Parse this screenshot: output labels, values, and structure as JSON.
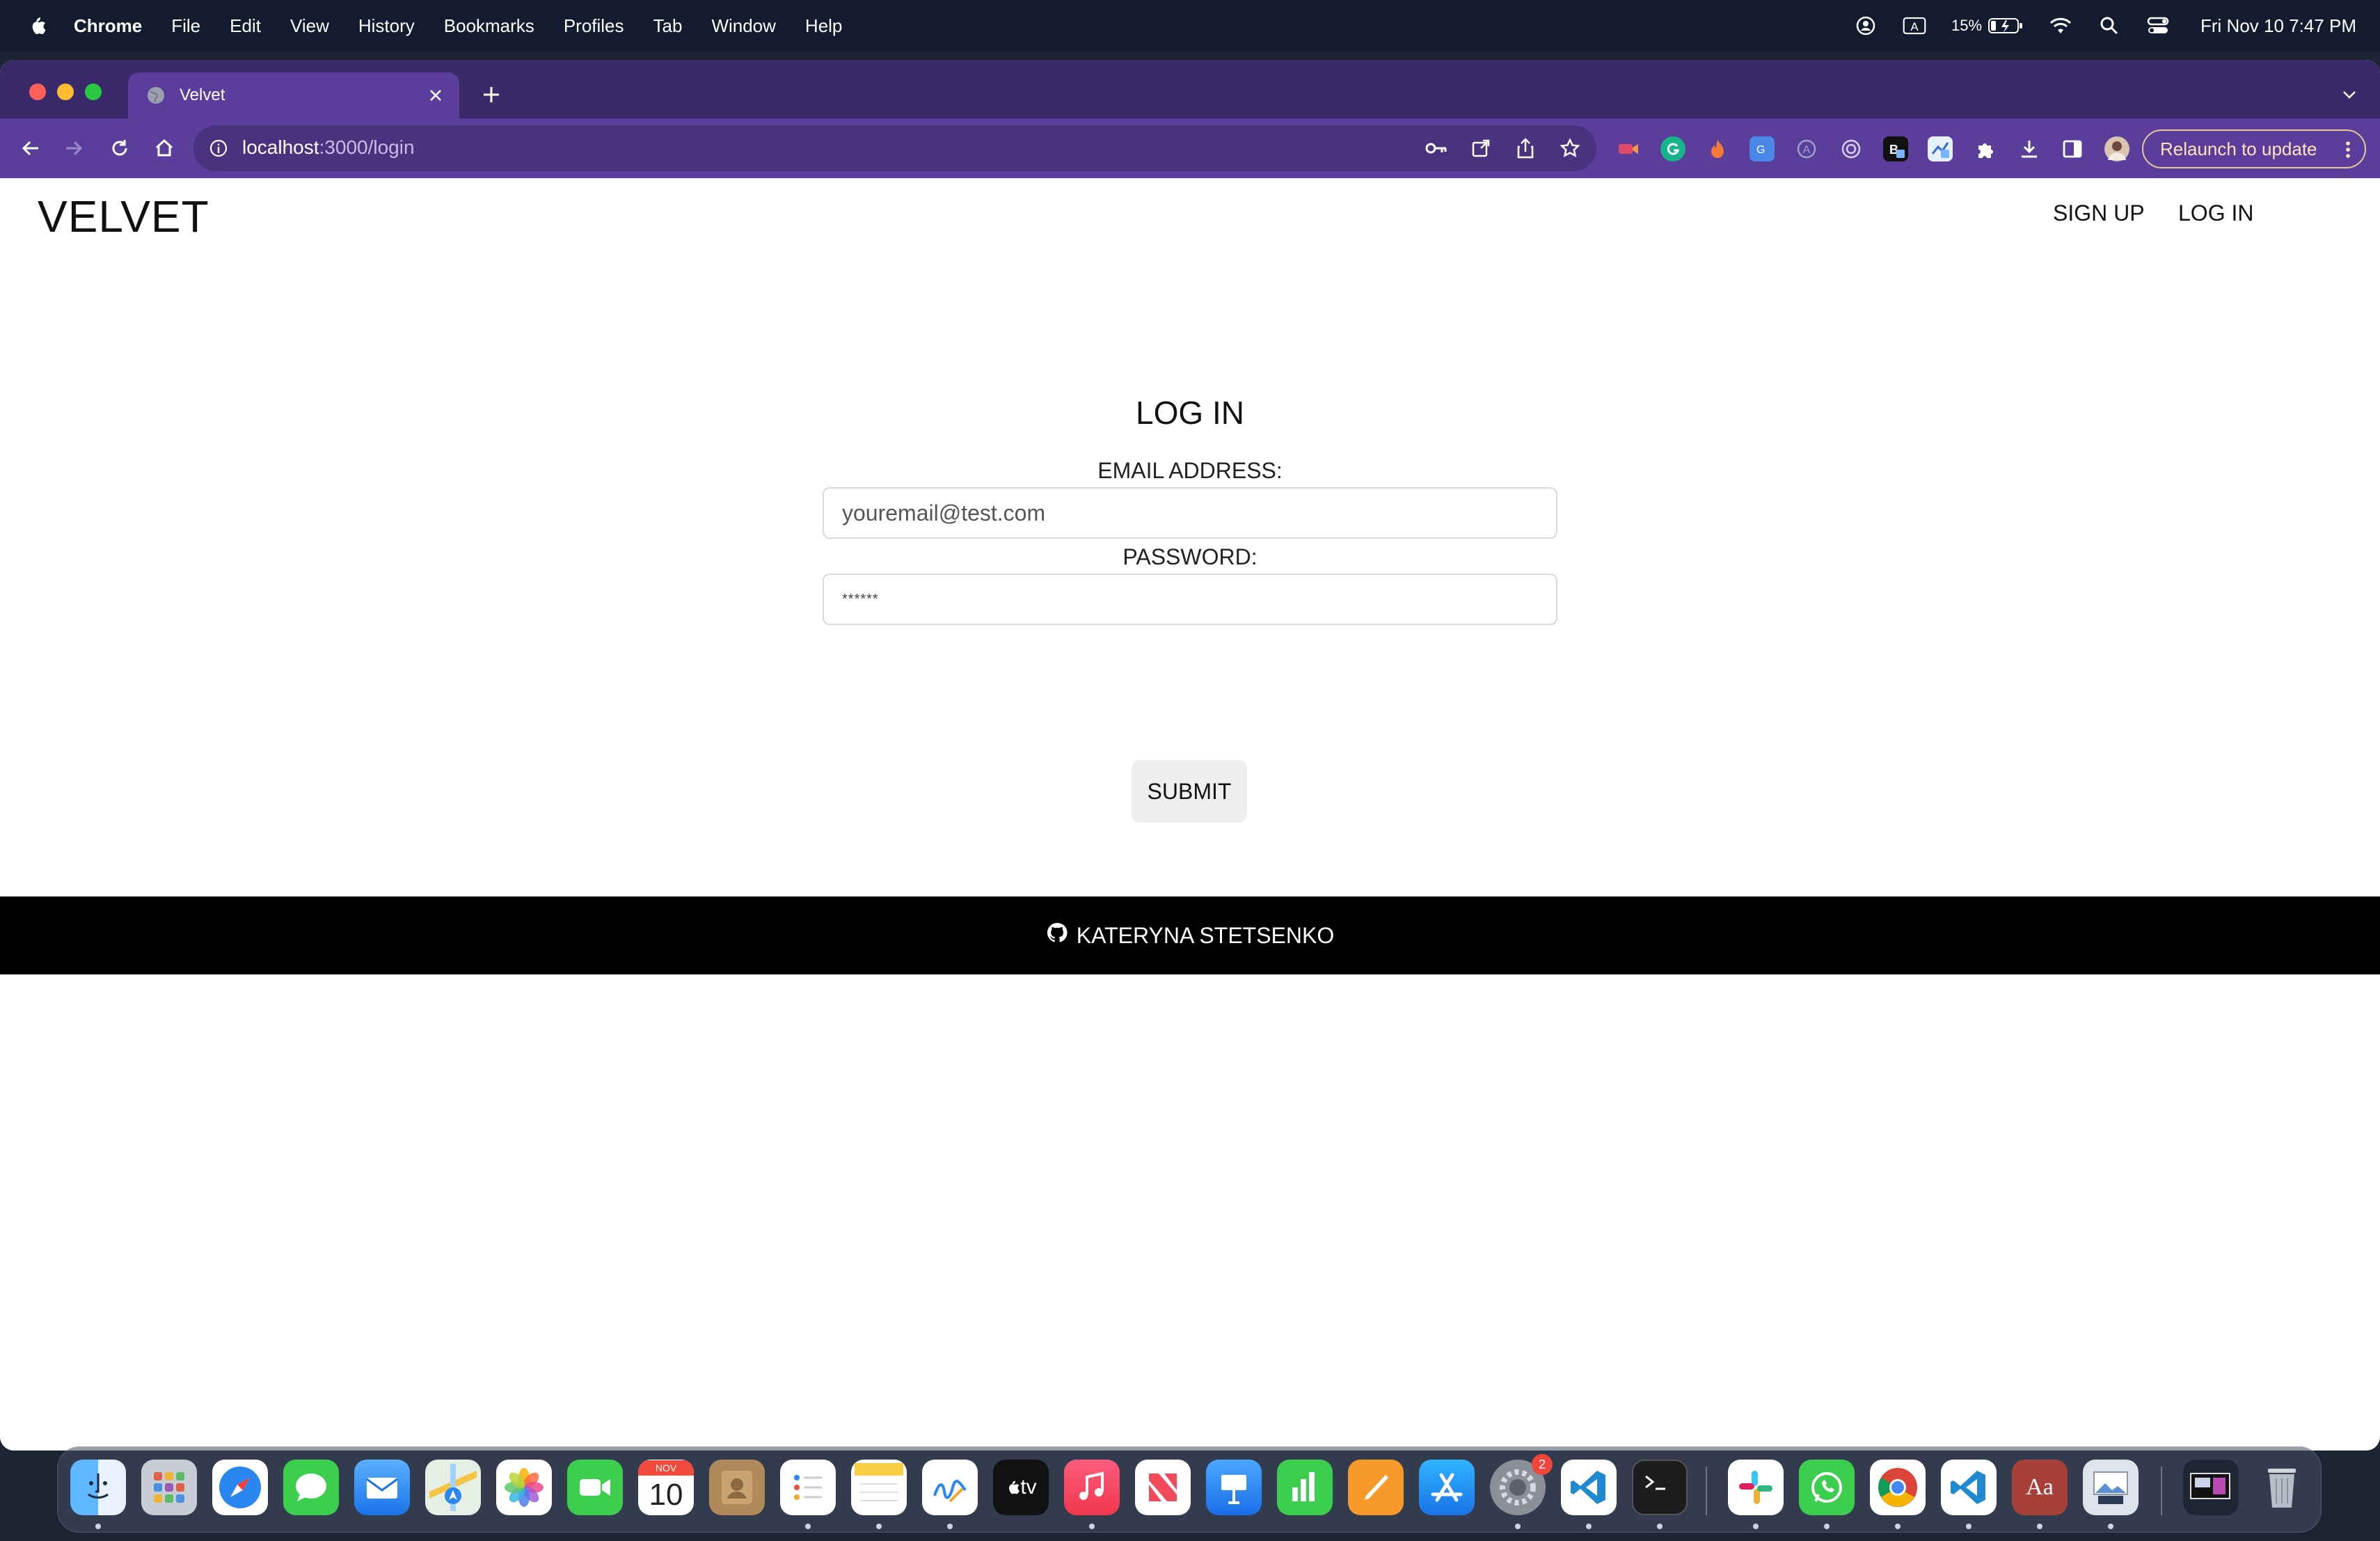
{
  "menubar": {
    "app_name": "Chrome",
    "items": [
      "File",
      "Edit",
      "View",
      "History",
      "Bookmarks",
      "Profiles",
      "Tab",
      "Window",
      "Help"
    ],
    "battery_percent": "15%",
    "clock": "Fri Nov 10  7:47 PM"
  },
  "browser": {
    "tab_title": "Velvet",
    "url_host": "localhost",
    "url_path": ":3000/login",
    "relaunch_label": "Relaunch to update",
    "colors": {
      "frame": "#3b2a6a",
      "toolbar": "#5b3e9c"
    }
  },
  "site": {
    "brand": "VELVET",
    "nav": {
      "signup": "SIGN UP",
      "login": "LOG IN"
    },
    "form": {
      "title": "LOG IN",
      "email_label": "EMAIL ADDRESS:",
      "email_placeholder": "youremail@test.com",
      "password_label": "PASSWORD:",
      "password_value": "******",
      "submit_label": "SUBMIT"
    },
    "footer": {
      "author": "KATERYNA STETSENKO"
    }
  },
  "dock": {
    "calendar_month": "NOV",
    "calendar_day": "10",
    "tv_label": "tv",
    "settings_badge": "2",
    "dictionary_label": "Aa"
  }
}
